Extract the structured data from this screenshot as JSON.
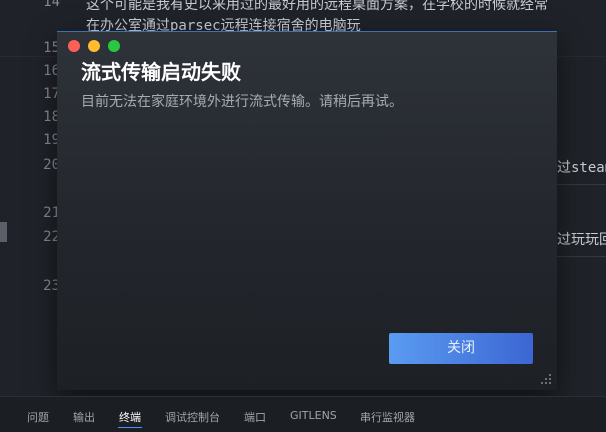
{
  "editor": {
    "line_numbers": [
      "14",
      "15",
      "16",
      "17",
      "18",
      "19",
      "20",
      "21",
      "22",
      "23"
    ],
    "lines": [
      "这个可能是我有史以来用过的最好用的远程桌面方案，在学校的时候就经常",
      "在办公室通过parsec远程连接宿舍的电脑玩"
    ],
    "fragment_20": "过steam",
    "fragment_22": "过玩玩回"
  },
  "dialog": {
    "title": "流式传输启动失败",
    "message": "目前无法在家庭环境外进行流式传输。请稍后再试。",
    "button_label": "关闭"
  },
  "panel": {
    "tabs": [
      "问题",
      "输出",
      "终端",
      "调试控制台",
      "端口",
      "GITLENS",
      "串行监视器"
    ],
    "active_tab": "终端"
  }
}
